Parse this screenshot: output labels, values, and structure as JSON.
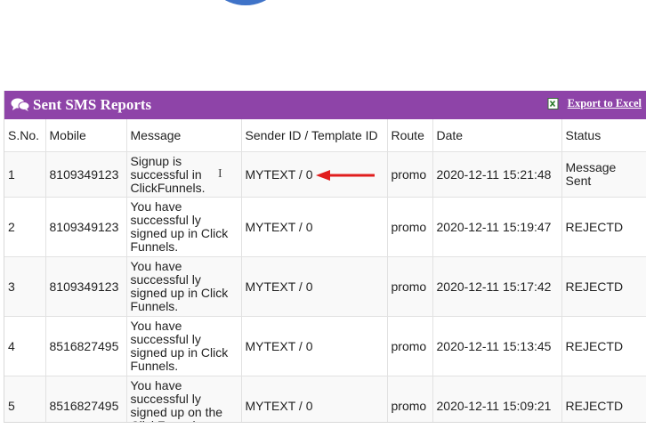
{
  "panel": {
    "title": "Sent SMS Reports",
    "export_label": "Export to Excel"
  },
  "columns": [
    "S.No.",
    "Mobile",
    "Message",
    "Sender ID / Template ID",
    "Route",
    "Date",
    "Status"
  ],
  "rows": [
    {
      "sno": "1",
      "mobile": "8109349123",
      "message": "Signup is successful in ClickFunnels.",
      "sender": "MYTEXT / 0",
      "route": "promo",
      "date": "2020-12-11 15:21:48",
      "status": "Message Sent"
    },
    {
      "sno": "2",
      "mobile": "8109349123",
      "message": "You have successful ly signed up in Click Funnels.",
      "sender": "MYTEXT / 0",
      "route": "promo",
      "date": "2020-12-11 15:19:47",
      "status": "REJECTD"
    },
    {
      "sno": "3",
      "mobile": "8109349123",
      "message": "You have successful ly signed up in Click Funnels.",
      "sender": "MYTEXT / 0",
      "route": "promo",
      "date": "2020-12-11 15:17:42",
      "status": "REJECTD"
    },
    {
      "sno": "4",
      "mobile": "8516827495",
      "message": "You have successful ly signed up in Click Funnels.",
      "sender": "MYTEXT / 0",
      "route": "promo",
      "date": "2020-12-11 15:13:45",
      "status": "REJECTD"
    },
    {
      "sno": "5",
      "mobile": "8516827495",
      "message": "You have successful ly signed up on the ClickFunnel",
      "sender": "MYTEXT / 0",
      "route": "promo",
      "date": "2020-12-11 15:09:21",
      "status": "REJECTD"
    }
  ],
  "colors": {
    "header_bg": "#8e44a8",
    "arrow": "#e11d1d"
  }
}
